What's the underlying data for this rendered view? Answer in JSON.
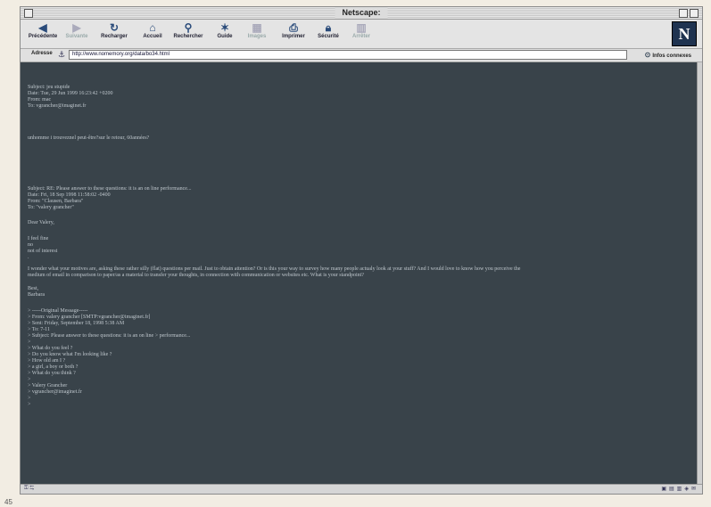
{
  "window": {
    "title": "Netscape:"
  },
  "toolbar": {
    "buttons": [
      {
        "label": "Précédente",
        "icon": "back-arrow-icon"
      },
      {
        "label": "Suivante",
        "icon": "forward-arrow-icon"
      },
      {
        "label": "Recharger",
        "icon": "reload-icon"
      },
      {
        "label": "Accueil",
        "icon": "home-icon"
      },
      {
        "label": "Rechercher",
        "icon": "search-icon"
      },
      {
        "label": "Guide",
        "icon": "guide-icon"
      },
      {
        "label": "Images",
        "icon": "images-icon"
      },
      {
        "label": "Imprimer",
        "icon": "print-icon"
      },
      {
        "label": "Sécurité",
        "icon": "lock-icon"
      },
      {
        "label": "Arrêter",
        "icon": "stop-icon"
      }
    ],
    "logo": "N"
  },
  "location": {
    "label": "Adresse",
    "url": "http://www.nomemory.org/data/bo34.html",
    "infos_label": "Infos connexes"
  },
  "email": {
    "msg1": {
      "header": [
        "Subject: jeu stupide",
        "Date: Tue, 29 Jun 1999 16:23:42 +0200",
        "From: mac",
        "To: vgrancher@imaginet.fr"
      ],
      "body": "unhomme i trouveznel peut-être?sur le retour, 60années?"
    },
    "msg2": {
      "header": [
        "Subject: RE: Please answer to these questions: it is an on line performance...",
        "Date: Fri, 18 Sep 1998 11:58:02 -0400",
        "From: \"Clausen, Barbara\"",
        "To: \"valery grancher\""
      ],
      "greeting": "Dear Valery,",
      "answers": [
        "I feel fine",
        "no",
        "not of interest",
        "."
      ],
      "paragraph": [
        "I wonder what your motives are, asking these rather silly (flat) questions per mail. Just to obtain attention? Or is this your way to survey how many people actualy look at your stuff? And I would love to know how you perceive the",
        "medium of email in comparison to paper/as a material to transfer your thoughts, in connection with communication or websites etc. What is your standpoint?"
      ],
      "signoff": [
        "Best,",
        "Barbara"
      ],
      "quoted": [
        "> -----Original Message-----",
        "> From: valery grancher [SMTP:vgrancher@imaginet.fr]",
        "> Sent: Friday, September 18, 1998 5:38 AM",
        "> To: 7-11",
        "> Subject: Please answer to these questions: it is an on line > performance...",
        ">",
        "> What do you feel ?",
        "> Do you know what I'm looking like ?",
        "> How old am I ?",
        "> a girl, a boy or both ?",
        "> What do you think ?",
        ">",
        "> Valery Grancher",
        "> vgrancher@imaginet.fr",
        ">",
        ">"
      ]
    }
  },
  "page_number": "45"
}
